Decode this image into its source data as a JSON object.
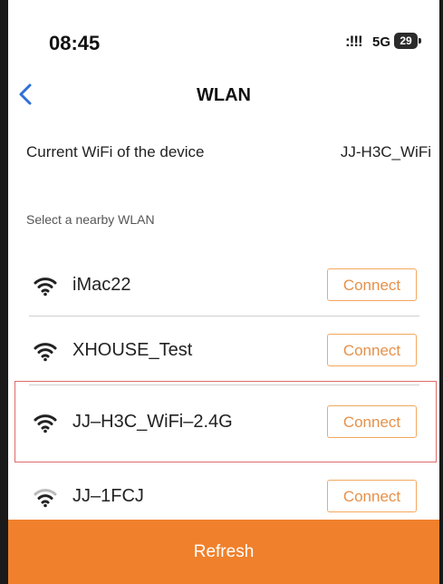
{
  "status_bar": {
    "time": "08:45",
    "signal": ":!!!",
    "network": "5G",
    "battery": "29"
  },
  "nav": {
    "title": "WLAN",
    "back_icon": "chevron-left-icon"
  },
  "current": {
    "label": "Current WiFi of the device",
    "value": "JJ-H3C_WiFi"
  },
  "section_label": "Select a nearby WLAN",
  "networks": [
    {
      "name": "iMac22",
      "button": "Connect",
      "icon": "wifi-icon"
    },
    {
      "name": "XHOUSE_Test",
      "button": "Connect",
      "icon": "wifi-icon"
    },
    {
      "name": "JJ–H3C_WiFi–2.4G",
      "button": "Connect",
      "icon": "wifi-icon"
    },
    {
      "name": "JJ–1FCJ",
      "button": "Connect",
      "icon": "wifi-icon"
    }
  ],
  "refresh_label": "Refresh",
  "colors": {
    "accent": "#f0802c",
    "connect_border": "#f2a860",
    "connect_text": "#e6914a",
    "highlight": "#e06a6a",
    "back_icon": "#2f6fd6"
  }
}
